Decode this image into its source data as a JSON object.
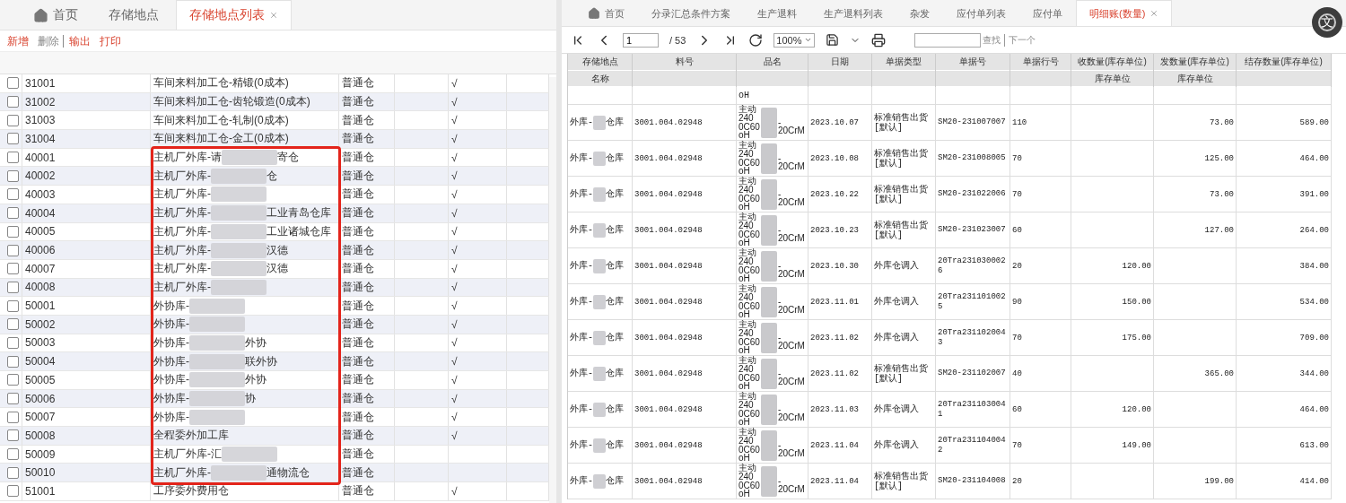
{
  "left": {
    "tabs": [
      {
        "label": "首页",
        "kind": "home",
        "selected": false
      },
      {
        "label": "存储地点",
        "selected": false
      },
      {
        "label": "存储地点列表",
        "selected": true,
        "closable": true
      }
    ],
    "toolbar": [
      {
        "label": "新增",
        "disabled": false
      },
      {
        "label": "删除",
        "disabled": true,
        "divider_after": true
      },
      {
        "label": "输出",
        "disabled": false
      },
      {
        "label": "打印",
        "disabled": false
      }
    ],
    "rows": [
      {
        "code": "31001",
        "name": "车间来料加工仓-精锻(0成本)",
        "type": "普通仓",
        "flag": "√",
        "checked": false
      },
      {
        "code": "31002",
        "name": "车间来料加工仓-齿轮锻造(0成本)",
        "type": "普通仓",
        "flag": "√",
        "checked": false
      },
      {
        "code": "31003",
        "name": "车间来料加工仓-轧制(0成本)",
        "type": "普通仓",
        "flag": "√",
        "checked": false
      },
      {
        "code": "31004",
        "name": "车间来料加工仓-金工(0成本)",
        "type": "普通仓",
        "flag": "√",
        "checked": false
      },
      {
        "code": "40001",
        "name": "主机厂外库-请",
        "redacted": true,
        "name_tail": "寄仓",
        "type": "普通仓",
        "flag": "√",
        "checked": false
      },
      {
        "code": "40002",
        "name": "主机厂外库-",
        "redacted": true,
        "name_tail": "仓",
        "type": "普通仓",
        "flag": "√",
        "checked": false
      },
      {
        "code": "40003",
        "name": "主机厂外库-",
        "redacted": true,
        "type": "普通仓",
        "flag": "√",
        "checked": false
      },
      {
        "code": "40004",
        "name": "主机厂外库-",
        "redacted": true,
        "name_tail": "工业青岛仓库",
        "type": "普通仓",
        "flag": "√",
        "checked": false
      },
      {
        "code": "40005",
        "name": "主机厂外库-",
        "redacted": true,
        "name_tail": "工业诸城仓库",
        "type": "普通仓",
        "flag": "√",
        "checked": false
      },
      {
        "code": "40006",
        "name": "主机厂外库-",
        "redacted": true,
        "name_tail": "汉德",
        "type": "普通仓",
        "flag": "√",
        "checked": false
      },
      {
        "code": "40007",
        "name": "主机厂外库-",
        "redacted": true,
        "name_tail": "汉德",
        "type": "普通仓",
        "flag": "√",
        "checked": false
      },
      {
        "code": "40008",
        "name": "主机厂外库-",
        "redacted": true,
        "type": "普通仓",
        "flag": "√",
        "checked": false
      },
      {
        "code": "50001",
        "name": "外协库-",
        "redacted": true,
        "type": "普通仓",
        "flag": "√",
        "checked": false
      },
      {
        "code": "50002",
        "name": "外协库-",
        "redacted": true,
        "type": "普通仓",
        "flag": "√",
        "checked": false
      },
      {
        "code": "50003",
        "name": "外协库-",
        "redacted": true,
        "name_tail": "外协",
        "type": "普通仓",
        "flag": "√",
        "checked": false
      },
      {
        "code": "50004",
        "name": "外协库-",
        "redacted": true,
        "name_tail": "联外协",
        "type": "普通仓",
        "flag": "√",
        "checked": false
      },
      {
        "code": "50005",
        "name": "外协库-",
        "redacted": true,
        "name_tail": "外协",
        "type": "普通仓",
        "flag": "√",
        "checked": false
      },
      {
        "code": "50006",
        "name": "外协库-",
        "redacted": true,
        "name_tail": "协",
        "type": "普通仓",
        "flag": "√",
        "checked": false
      },
      {
        "code": "50007",
        "name": "外协库-",
        "redacted": true,
        "type": "普通仓",
        "flag": "√",
        "checked": false
      },
      {
        "code": "50008",
        "name": "全程委外加工库",
        "type": "普通仓",
        "flag": "√",
        "checked": false
      },
      {
        "code": "50009",
        "name": "主机厂外库-汇",
        "redacted": true,
        "type": "普通仓",
        "checked": false
      },
      {
        "code": "50010",
        "name": "主机厂外库-",
        "redacted": true,
        "name_tail": "通物流仓",
        "type": "普通仓",
        "checked": false
      },
      {
        "code": "51001",
        "name": "工序委外费用仓",
        "type": "普通仓",
        "flag": "√",
        "checked": false
      }
    ]
  },
  "right": {
    "tabs": [
      {
        "label": "首页",
        "kind": "home",
        "selected": false
      },
      {
        "label": "分录汇总条件方案",
        "selected": false
      },
      {
        "label": "生产退料",
        "selected": false
      },
      {
        "label": "生产退料列表",
        "selected": false
      },
      {
        "label": "杂发",
        "selected": false
      },
      {
        "label": "应付单列表",
        "selected": false
      },
      {
        "label": "应付单",
        "selected": false
      },
      {
        "label": "明细账(数量)",
        "selected": true,
        "closable": true
      }
    ],
    "translate_button": "文",
    "pager": {
      "page": "1",
      "total": "/ 53",
      "zoom": "100%"
    },
    "search": {
      "find": "查找",
      "next": "下一个"
    },
    "columns": [
      {
        "label": "存储地点",
        "sub": "名称"
      },
      {
        "label": "料号"
      },
      {
        "label": "品名"
      },
      {
        "label": "日期"
      },
      {
        "label": "单据类型"
      },
      {
        "label": "单据号"
      },
      {
        "label": "单据行号"
      },
      {
        "label": "收数量(库存单位)",
        "sub": "库存单位"
      },
      {
        "label": "发数量(库存单位)",
        "sub": "库存单位"
      },
      {
        "label": "结存数量(库存单位)"
      }
    ],
    "top_fragment": "oH",
    "rows": [
      {
        "store": "外库-",
        "store_tail": "仓库",
        "material": "3001.004.02948",
        "product": "主动\n240\n0C60\noH",
        "product_tail": "\n-\n20CrM",
        "date": "2023.10.07",
        "doc_type": "标准销售出货[默认]",
        "doc_no": "SM20-231007007",
        "line_no": "110",
        "issued": "73.00",
        "balance": "589.00"
      },
      {
        "store": "外库-",
        "store_tail": "仓库",
        "material": "3001.004.02948",
        "product": "主动\n240\n0C60\noH",
        "product_tail": "\n-\n20CrM",
        "date": "2023.10.08",
        "doc_type": "标准销售出货[默认]",
        "doc_no": "SM20-231008005",
        "line_no": "70",
        "issued": "125.00",
        "balance": "464.00"
      },
      {
        "store": "外库-",
        "store_tail": "仓库",
        "material": "3001.004.02948",
        "product": "主动\n240\n0C60\noH",
        "product_tail": "\n-\n20CrM",
        "date": "2023.10.22",
        "doc_type": "标准销售出货[默认]",
        "doc_no": "SM20-231022006",
        "line_no": "70",
        "issued": "73.00",
        "balance": "391.00"
      },
      {
        "store": "外库-",
        "store_tail": "仓库",
        "material": "3001.004.02948",
        "product": "主动\n240\n0C60\noH",
        "product_tail": "\n-\n20CrM",
        "date": "2023.10.23",
        "doc_type": "标准销售出货[默认]",
        "doc_no": "SM20-231023007",
        "line_no": "60",
        "issued": "127.00",
        "balance": "264.00"
      },
      {
        "store": "外库-",
        "store_tail": "仓库",
        "material": "3001.004.02948",
        "product": "主动\n240\n0C60\noH",
        "product_tail": "\n-\n20CrM",
        "date": "2023.10.30",
        "doc_type": "外库仓调入",
        "doc_no": "20Tra2310300026",
        "line_no": "20",
        "received": "120.00",
        "balance": "384.00"
      },
      {
        "store": "外库-",
        "store_tail": "仓库",
        "material": "3001.004.02948",
        "product": "主动\n240\n0C60\noH",
        "product_tail": "\n-\n20CrM",
        "date": "2023.11.01",
        "doc_type": "外库仓调入",
        "doc_no": "20Tra2311010025",
        "line_no": "90",
        "received": "150.00",
        "balance": "534.00"
      },
      {
        "store": "外库-",
        "store_tail": "仓库",
        "material": "3001.004.02948",
        "product": "主动\n240\n0C60\noH",
        "product_tail": "\n-\n20CrM",
        "date": "2023.11.02",
        "doc_type": "外库仓调入",
        "doc_no": "20Tra2311020043",
        "line_no": "70",
        "received": "175.00",
        "balance": "709.00"
      },
      {
        "store": "外库-",
        "store_tail": "仓库",
        "material": "3001.004.02948",
        "product": "主动\n240\n0C60\noH",
        "product_tail": "\n-\n20CrM",
        "date": "2023.11.02",
        "doc_type": "标准销售出货[默认]",
        "doc_no": "SM20-231102007",
        "line_no": "40",
        "issued": "365.00",
        "balance": "344.00"
      },
      {
        "store": "外库-",
        "store_tail": "仓库",
        "material": "3001.004.02948",
        "product": "主动\n240\n0C60\noH",
        "product_tail": "\n-\n20CrM",
        "date": "2023.11.03",
        "doc_type": "外库仓调入",
        "doc_no": "20Tra2311030041",
        "line_no": "60",
        "received": "120.00",
        "balance": "464.00"
      },
      {
        "store": "外库-",
        "store_tail": "仓库",
        "material": "3001.004.02948",
        "product": "主动\n240\n0C60\noH",
        "product_tail": "\n-\n20CrM",
        "date": "2023.11.04",
        "doc_type": "外库仓调入",
        "doc_no": "20Tra2311040042",
        "line_no": "70",
        "received": "149.00",
        "balance": "613.00"
      },
      {
        "store": "外库-",
        "store_tail": "仓库",
        "material": "3001.004.02948",
        "product": "主动\n240\n0C60\noH",
        "product_tail": "\n-\n20CrM",
        "date": "2023.11.04",
        "doc_type": "标准销售出货[默认]",
        "doc_no": "SM20-231104008",
        "line_no": "20",
        "issued": "199.00",
        "balance": "414.00"
      }
    ]
  }
}
